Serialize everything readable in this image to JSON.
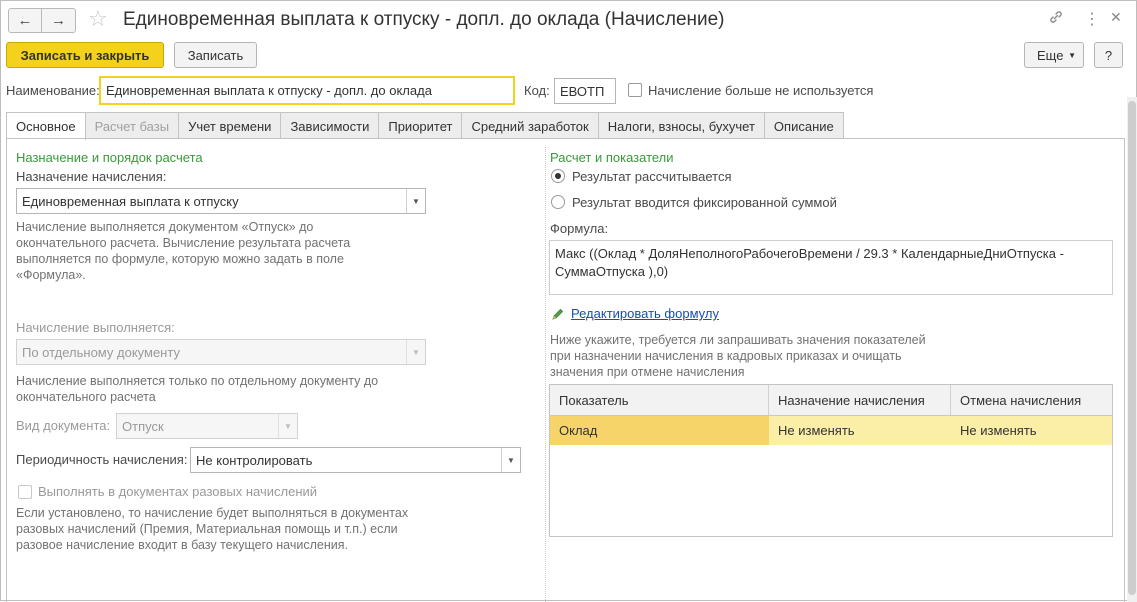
{
  "window": {
    "title": "Единовременная выплата к отпуску - допл. до оклада (Начисление)",
    "icons": {
      "back": "arrow-left-icon",
      "forward": "arrow-right-icon",
      "favorite": "star-icon",
      "link": "link-icon",
      "menu": "more-vert-icon",
      "close": "close-icon"
    }
  },
  "toolbar": {
    "save_close_label": "Записать и закрыть",
    "save_label": "Записать",
    "more_label": "Еще",
    "help_label": "?"
  },
  "header": {
    "name_label": "Наименование:",
    "name_value": "Единовременная выплата к отпуску - допл. до оклада",
    "code_label": "Код:",
    "code_value": "ЕВОТП",
    "unused_label": "Начисление больше не используется"
  },
  "tabs": [
    {
      "label": "Основное"
    },
    {
      "label": "Расчет базы"
    },
    {
      "label": "Учет времени"
    },
    {
      "label": "Зависимости"
    },
    {
      "label": "Приоритет"
    },
    {
      "label": "Средний заработок"
    },
    {
      "label": "Налоги, взносы, бухучет"
    },
    {
      "label": "Описание"
    }
  ],
  "left": {
    "section_title": "Назначение и порядок расчета",
    "purpose_label": "Назначение начисления:",
    "purpose_value": "Единовременная выплата к отпуску",
    "purpose_note": "Начисление выполняется документом «Отпуск» до окончательного расчета. Вычисление результата расчета выполняется по формуле, которую можно задать в поле «Формула».",
    "executed_label": "Начисление выполняется:",
    "executed_value": "По отдельному документу",
    "executed_note": "Начисление выполняется только по отдельному документу до окончательного расчета",
    "doc_type_label": "Вид документа:",
    "doc_type_value": "Отпуск",
    "periodicity_label": "Периодичность начисления:",
    "periodicity_value": "Не контролировать",
    "one_time_label": "Выполнять в документах разовых начислений",
    "one_time_note": "Если установлено, то начисление будет выполняться в документах разовых начислений (Премия, Материальная помощь и т.п.) если разовое начисление входит в базу текущего начисления."
  },
  "right": {
    "section_title": "Расчет и показатели",
    "radio_calculated": "Результат рассчитывается",
    "radio_fixed": "Результат вводится фиксированной суммой",
    "formula_label": "Формула:",
    "formula_value": "Макс ((Оклад * ДоляНеполногоРабочегоВремени / 29.3 * КалендарныеДниОтпуска - СуммаОтпуска ),0)",
    "edit_formula_label": "Редактировать формулу",
    "indicators_note": "Ниже укажите, требуется ли запрашивать значения показателей при назначении начисления в кадровых приказах и очищать значения при отмене начисления",
    "table": {
      "headers": [
        "Показатель",
        "Назначение начисления",
        "Отмена начисления"
      ],
      "rows": [
        [
          "Оклад",
          "Не изменять",
          "Не изменять"
        ]
      ]
    }
  },
  "colors": {
    "accent": "#f3d11c",
    "section": "#3a9a3a",
    "link": "#1a4ea6",
    "selected_row": "#fbeea6"
  }
}
